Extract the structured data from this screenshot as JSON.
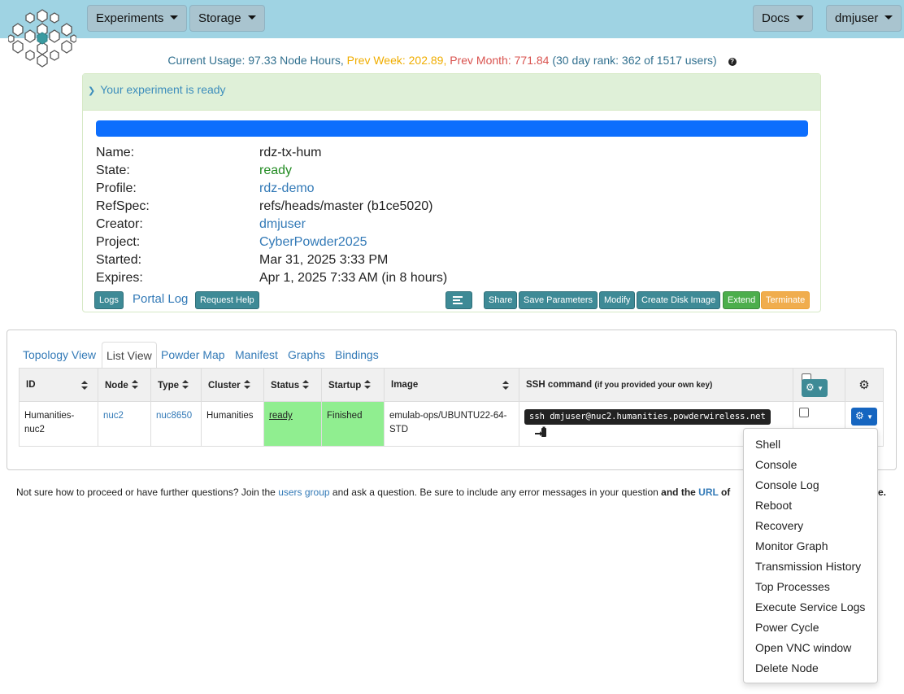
{
  "navbar": {
    "menus": [
      "Experiments",
      "Storage"
    ],
    "right_menus": [
      "Docs",
      "dmjuser"
    ],
    "logo": "snowflake-logo"
  },
  "usage": {
    "current": "Current Usage: 97.33 Node Hours,",
    "prev_week": "Prev Week: 202.89,",
    "prev_month": "Prev Month: 771.84",
    "rank": "(30 day rank: 362 of 1517 users)",
    "help": "?"
  },
  "experiment": {
    "heading": "Your experiment is ready",
    "progress_fraction": 1.0,
    "progress_color": "#0d6efd",
    "fields": [
      {
        "label": "Name:",
        "value": "rdz-tx-hum"
      },
      {
        "label": "State:",
        "value": "ready"
      },
      {
        "label": "Profile:",
        "value": "rdz-demo"
      },
      {
        "label": "RefSpec:",
        "value": "refs/heads/master (b1ce5020)"
      },
      {
        "label": "Creator:",
        "value": "dmjuser"
      },
      {
        "label": "Project:",
        "value": "CyberPowder2025"
      },
      {
        "label": "Started:",
        "value": "Mar 31, 2025 3:33 PM"
      },
      {
        "label": "Expires:",
        "value": "Apr 1, 2025 7:33 AM (in 8 hours)"
      }
    ],
    "buttons": {
      "logs": "Logs",
      "portal_log": "Portal Log",
      "request_help": "Request Help",
      "share": "Share",
      "save_parameters": "Save Parameters",
      "modify": "Modify",
      "create_disk_image": "Create Disk Image",
      "extend": "Extend",
      "terminate": "Terminate"
    }
  },
  "tabs": [
    "Topology View",
    "List View",
    "Powder Map",
    "Manifest",
    "Graphs",
    "Bindings"
  ],
  "active_tab": "List View",
  "table": {
    "headers": {
      "id": "ID",
      "node": "Node",
      "type": "Type",
      "cluster": "Cluster",
      "status": "Status",
      "startup": "Startup",
      "image": "Image",
      "ssh": "SSH command",
      "ssh_note": "(if you provided your own key)"
    },
    "rows": [
      {
        "id": "Humanities-nuc2",
        "node": "nuc2",
        "type": "nuc8650",
        "cluster": "Humanities",
        "status": "ready",
        "startup": "Finished",
        "image": "emulab-ops/UBUNTU22-64-STD",
        "ssh": "ssh dmjuser@nuc2.humanities.powderwireless.net"
      }
    ]
  },
  "footnote": {
    "part1": "Not sure how to proceed or have further questions? Join the ",
    "link1": "users group",
    "part2": " and ask a question. Be sure to include any error messages in your question ",
    "bold1": "and the ",
    "link2": "URL",
    "bold2": " of",
    "tail": "e."
  },
  "node_menu": [
    "Shell",
    "Console",
    "Console Log",
    "Reboot",
    "Recovery",
    "Monitor Graph",
    "Transmission History",
    "Top Processes",
    "Execute Service Logs",
    "Power Cycle",
    "Open VNC window",
    "Delete Node"
  ]
}
